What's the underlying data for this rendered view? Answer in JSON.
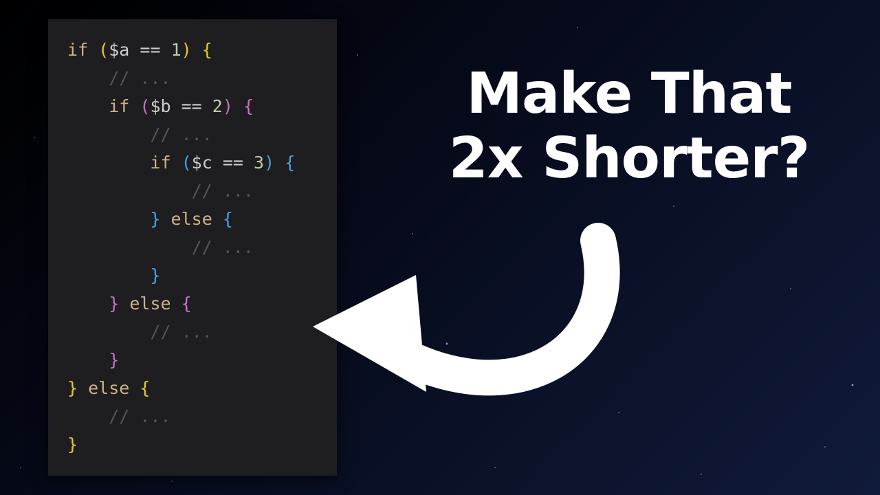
{
  "colors": {
    "bg_dark": "#050816",
    "card_bg": "#1e1e20",
    "keyword": "#cdb187",
    "bracket1": "#e7c631",
    "bracket2": "#c86fca",
    "bracket3": "#4aa0e0",
    "number": "#b5cea8",
    "comment": "#555555",
    "text": "#ffffff"
  },
  "headline": {
    "line1": "Make That",
    "line2": "2x Shorter?"
  },
  "code": {
    "language_hint": "php-like pseudocode",
    "tokens": {
      "if": "if",
      "else": "else",
      "var_a": "$a",
      "var_b": "$b",
      "var_c": "$c",
      "eq": "==",
      "num1": "1",
      "num2": "2",
      "num3": "3",
      "cmt": "// ..."
    },
    "raw": "if ($a == 1) {\n    // ...\n    if ($b == 2) {\n        // ...\n        if ($c == 3) {\n            // ...\n        } else {\n            // ...\n        }\n    } else {\n        // ...\n    }\n} else {\n    // ...\n}"
  },
  "arrow": {
    "name": "curved-arrow-icon"
  }
}
